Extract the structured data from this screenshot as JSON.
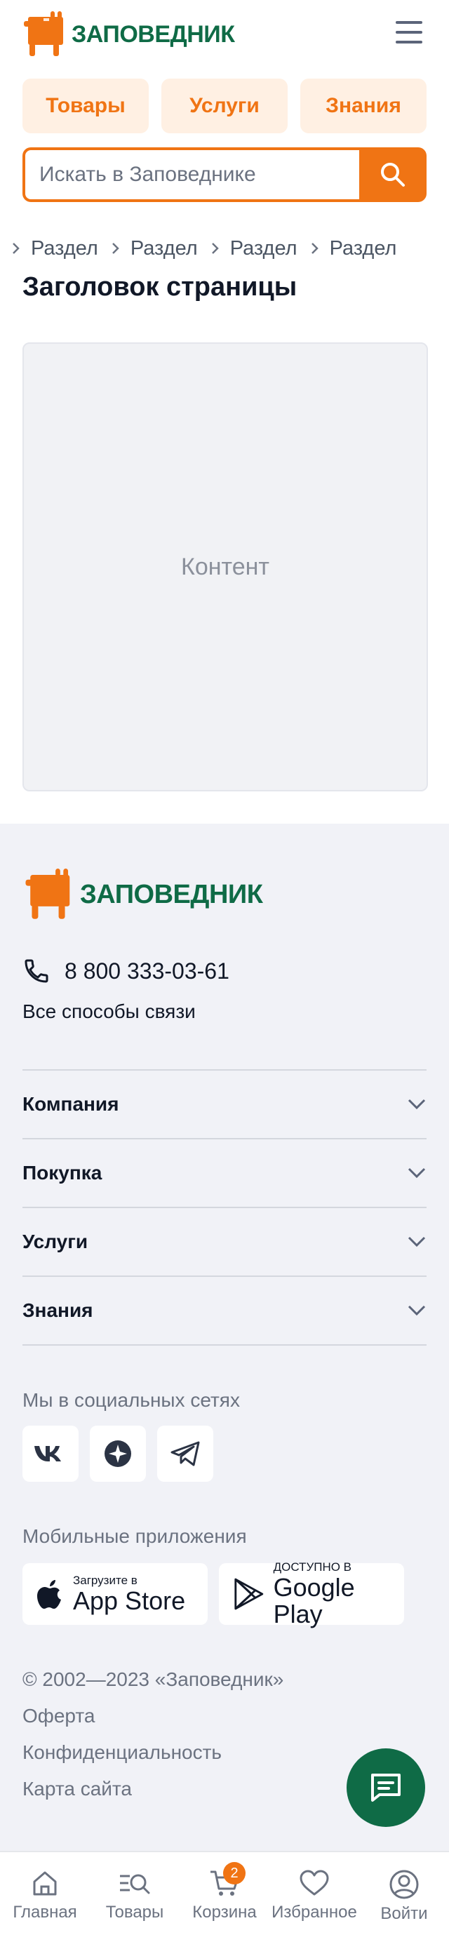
{
  "brand": {
    "name": "ЗАПОВЕДНИК",
    "accent": "#F07414",
    "green": "#0F6B46"
  },
  "header": {
    "menu_icon": "hamburger-icon"
  },
  "tabs": [
    {
      "label": "Товары"
    },
    {
      "label": "Услуги"
    },
    {
      "label": "Знания"
    }
  ],
  "search": {
    "placeholder": "Искать в Заповеднике",
    "icon": "search-icon"
  },
  "breadcrumb": [
    {
      "label": "Раздел"
    },
    {
      "label": "Раздел"
    },
    {
      "label": "Раздел"
    },
    {
      "label": "Раздел"
    }
  ],
  "page": {
    "title": "Заголовок страницы",
    "content_placeholder": "Контент"
  },
  "footer": {
    "phone": "8 800 333-03-61",
    "contacts_link": "Все способы связи",
    "accordion": [
      {
        "label": "Компания"
      },
      {
        "label": "Покупка"
      },
      {
        "label": "Услуги"
      },
      {
        "label": "Знания"
      }
    ],
    "socials_title": "Мы в социальных сетях",
    "socials": [
      {
        "icon": "vk-icon"
      },
      {
        "icon": "odnoklassniki-icon"
      },
      {
        "icon": "telegram-icon"
      }
    ],
    "apps_title": "Мобильные приложения",
    "apps": [
      {
        "small": "Загрузите в",
        "big": "App Store",
        "icon": "apple-icon"
      },
      {
        "small": "ДОСТУПНО В",
        "big": "Google Play",
        "icon": "google-play-icon"
      }
    ],
    "copyright": "© 2002—2023 «Заповедник»",
    "links": [
      {
        "label": "Оферта"
      },
      {
        "label": "Конфиденциальность"
      },
      {
        "label": "Карта сайта"
      }
    ],
    "chat_icon": "chat-icon"
  },
  "bottom_nav": [
    {
      "label": "Главная",
      "icon": "home-icon"
    },
    {
      "label": "Товары",
      "icon": "catalog-search-icon"
    },
    {
      "label": "Корзина",
      "icon": "cart-icon",
      "badge": "2"
    },
    {
      "label": "Избранное",
      "icon": "heart-icon"
    },
    {
      "label": "Войти",
      "icon": "user-icon"
    }
  ]
}
